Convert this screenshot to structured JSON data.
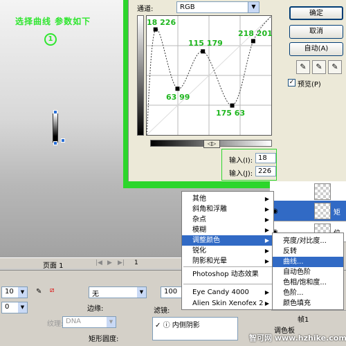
{
  "canvas": {
    "instruction": "选择曲线 参数如下",
    "step_number": "1"
  },
  "dialog": {
    "channel_label": "通道:",
    "channel_value": "RGB",
    "points": [
      {
        "label": "18  226"
      },
      {
        "label": "63  99"
      },
      {
        "label": "115  179"
      },
      {
        "label": "175  63"
      },
      {
        "label": "218  201"
      }
    ],
    "input_label": "输入(I):",
    "output_label": "输入(J):",
    "input_value": "18",
    "output_value": "226",
    "buttons": {
      "ok": "确定",
      "cancel": "取消",
      "auto": "自动(A)"
    },
    "preview_label": "预览(P)",
    "preview_checked": "✓"
  },
  "layers": {
    "rows": [
      {
        "name": ""
      },
      {
        "name": "矩"
      },
      {
        "name": "位"
      }
    ]
  },
  "menu1": {
    "items": [
      {
        "label": "其他",
        "submenu": true
      },
      {
        "label": "斜角和浮雕",
        "submenu": true
      },
      {
        "label": "杂点",
        "submenu": true
      },
      {
        "label": "模糊",
        "submenu": true
      },
      {
        "label": "调整颜色",
        "submenu": true
      },
      {
        "label": "锐化",
        "submenu": true
      },
      {
        "label": "阴影和光晕",
        "submenu": true
      },
      {
        "label": "Photoshop 动态效果",
        "submenu": false
      },
      {
        "label": "Eye Candy 4000",
        "submenu": true
      },
      {
        "label": "Alien Skin Xenofex 2",
        "submenu": true
      }
    ]
  },
  "menu2": {
    "items": [
      {
        "label": "亮度/对比度..."
      },
      {
        "label": "反转"
      },
      {
        "label": "曲线..."
      },
      {
        "label": "自动色阶"
      },
      {
        "label": "色相/饱和度..."
      },
      {
        "label": "色阶..."
      },
      {
        "label": "颜色填充"
      }
    ]
  },
  "timeline": {
    "page_label": "页面 1",
    "frame_number": "1"
  },
  "props": {
    "size_a": "10",
    "size_b": "0",
    "fill_value": "无",
    "edge_label": "边缘:",
    "texture_label": "纹理:",
    "texture_value": "DNA",
    "corner_label": "矩形圆度:",
    "opacity_value": "100",
    "filter_label": "滤镜:",
    "filter_item": "内侧阴影",
    "frame_tab": "帧1",
    "frame_item": "调色板"
  },
  "watermark": "智可网 www.hzhike.com"
}
